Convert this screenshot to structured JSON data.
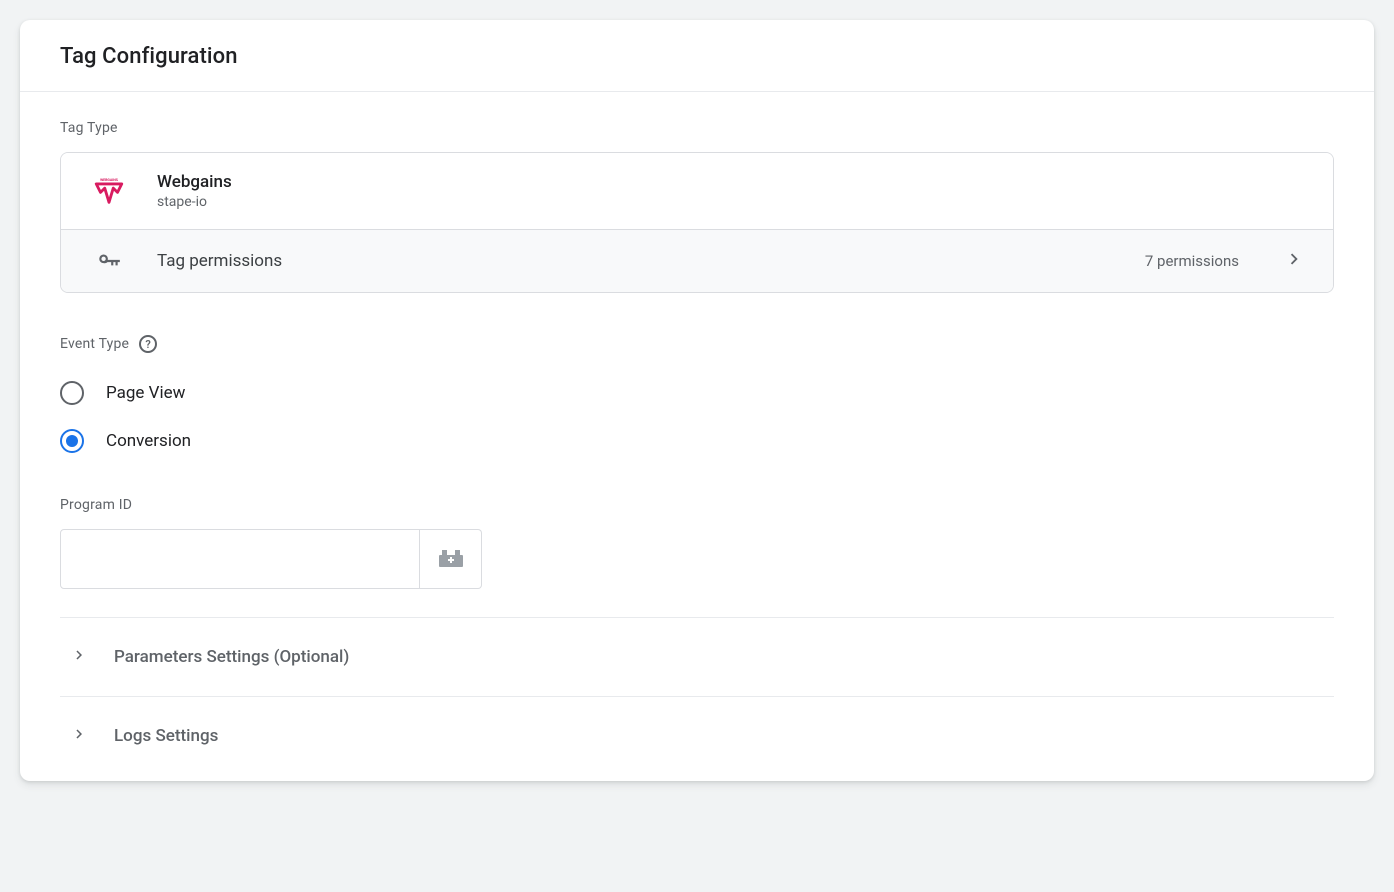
{
  "header": {
    "title": "Tag Configuration"
  },
  "tagType": {
    "sectionLabel": "Tag Type",
    "name": "Webgains",
    "vendor": "stape-io",
    "permissionsLabel": "Tag permissions",
    "permissionsCount": "7 permissions"
  },
  "eventType": {
    "sectionLabel": "Event Type",
    "options": {
      "pageView": "Page View",
      "conversion": "Conversion"
    },
    "selected": "conversion"
  },
  "programId": {
    "label": "Program ID",
    "value": ""
  },
  "collapsibles": {
    "params": "Parameters Settings (Optional)",
    "logs": "Logs Settings"
  }
}
